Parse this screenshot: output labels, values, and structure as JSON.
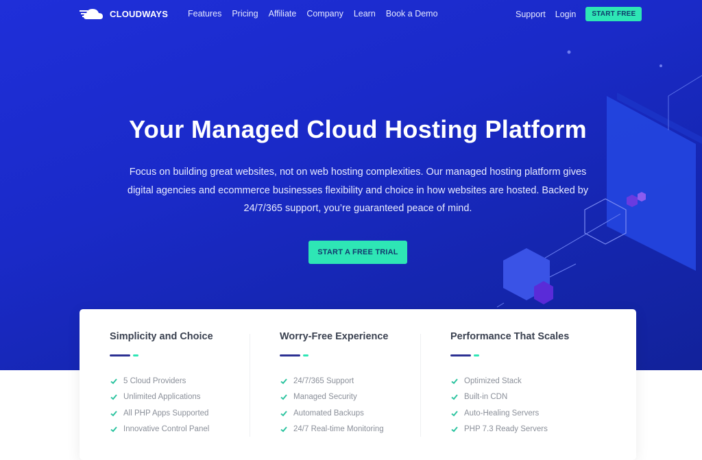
{
  "colors": {
    "hero_bg": "#1a2ac8",
    "accent": "#2ee6b5",
    "underline_primary": "#2c3193"
  },
  "nav": {
    "logo_text": "CLOUDWAYS",
    "logo_icon": "cloud-icon",
    "links": [
      "Features",
      "Pricing",
      "Affiliate",
      "Company",
      "Learn",
      "Book a Demo"
    ],
    "right_links": [
      "Support",
      "Login"
    ],
    "start_free_label": "START FREE"
  },
  "hero": {
    "title": "Your Managed Cloud Hosting Platform",
    "subtitle": "Focus on building great websites, not on web hosting complexities. Our managed hosting platform gives digital agencies and ecommerce businesses flexibility and choice in how websites are hosted. Backed by 24/7/365 support, you’re guaranteed peace of mind.",
    "cta_label": "START A FREE TRIAL"
  },
  "features": [
    {
      "title": "Simplicity and Choice",
      "items": [
        "5 Cloud Providers",
        "Unlimited Applications",
        "All PHP Apps Supported",
        "Innovative Control Panel"
      ]
    },
    {
      "title": "Worry-Free Experience",
      "items": [
        "24/7/365 Support",
        "Managed Security",
        "Automated Backups",
        "24/7 Real-time Monitoring"
      ]
    },
    {
      "title": "Performance That Scales",
      "items": [
        "Optimized Stack",
        "Built-in CDN",
        "Auto-Healing Servers",
        "PHP 7.3 Ready Servers"
      ]
    }
  ]
}
